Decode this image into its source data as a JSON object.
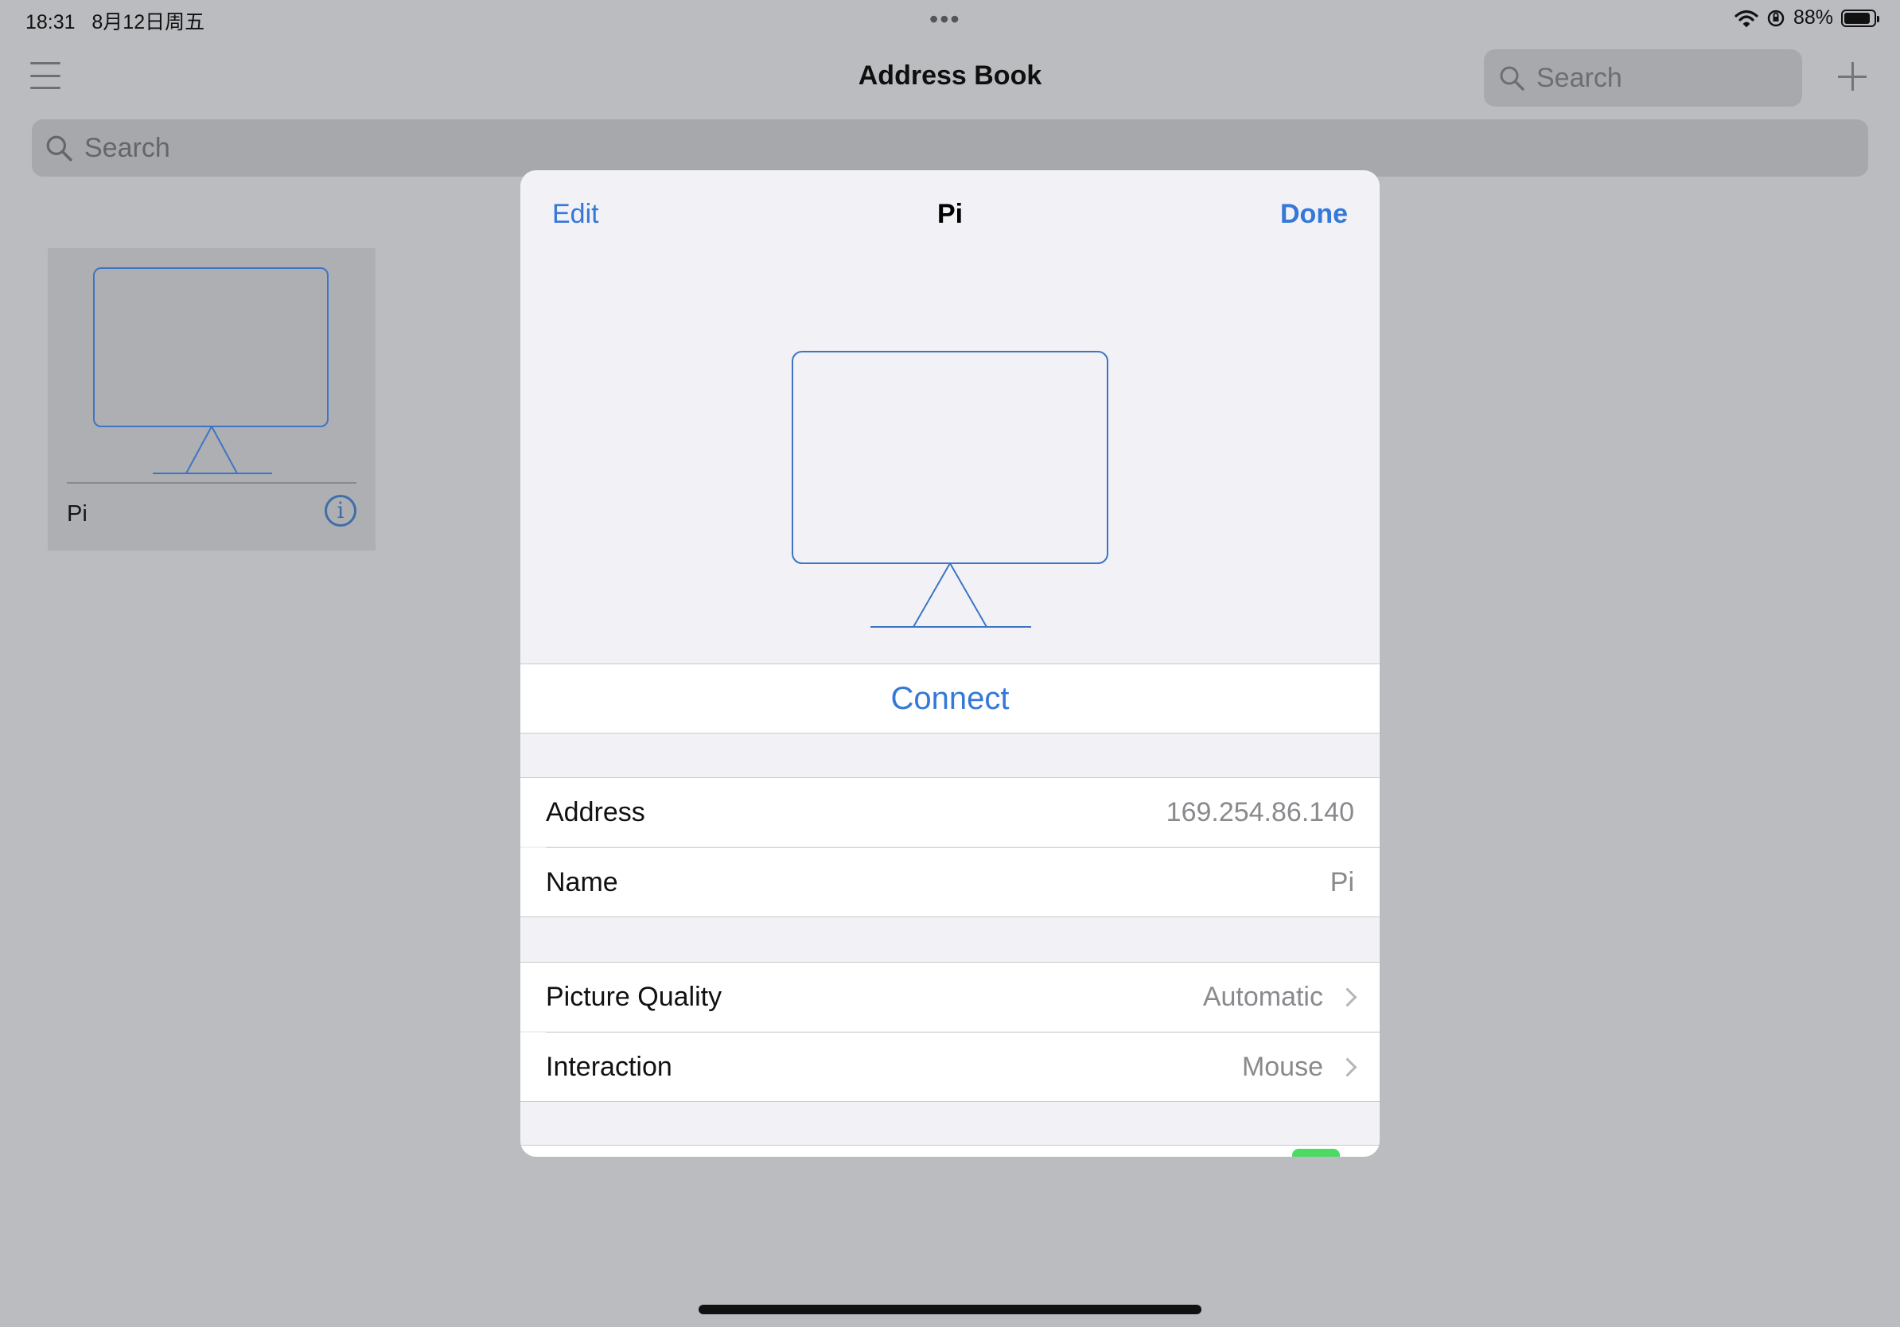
{
  "status_bar": {
    "time": "18:31",
    "date": "8月12日周五",
    "multitask_dots": "•••",
    "battery_percent": "88%",
    "battery_level": 0.88
  },
  "nav": {
    "title": "Address Book",
    "search_placeholder": "Search",
    "menu_icon": "hamburger-icon",
    "add_icon": "plus-icon"
  },
  "main_search": {
    "placeholder": "Search"
  },
  "computers": [
    {
      "name": "Pi",
      "info_icon": "info-icon"
    }
  ],
  "modal": {
    "edit_label": "Edit",
    "title": "Pi",
    "done_label": "Done",
    "connect_label": "Connect",
    "connection_rows": [
      {
        "label": "Address",
        "value": "169.254.86.140"
      },
      {
        "label": "Name",
        "value": "Pi"
      }
    ],
    "settings_rows": [
      {
        "label": "Picture Quality",
        "value": "Automatic"
      },
      {
        "label": "Interaction",
        "value": "Mouse"
      }
    ]
  },
  "colors": {
    "accent": "#3478d9",
    "dimmed_background": "#bbbcc0",
    "sheet_background": "#f1f1f6",
    "toggle_on": "#4cd964"
  }
}
